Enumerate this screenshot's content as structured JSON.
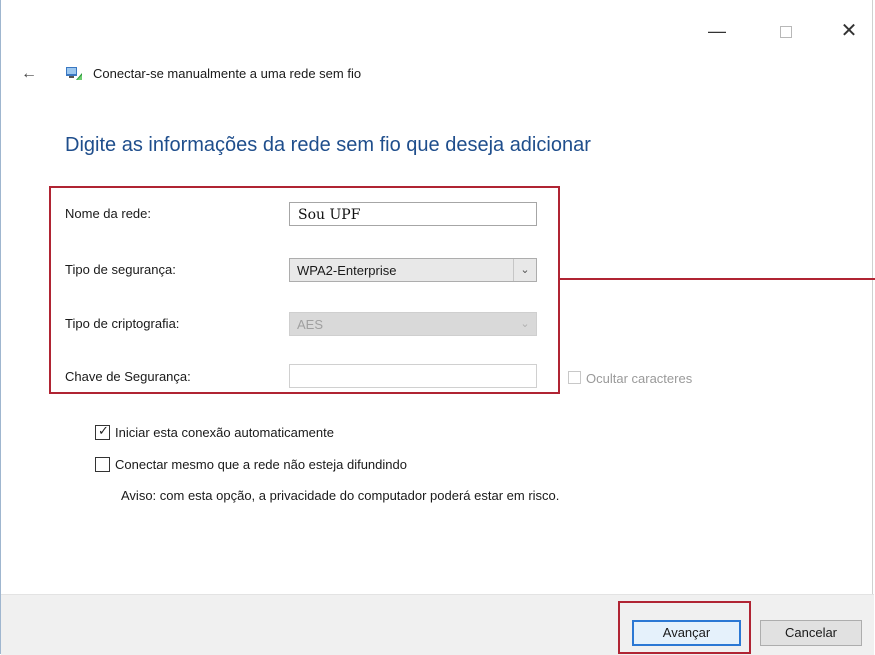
{
  "window": {
    "title": "Conectar-se manualmente a uma rede sem fio",
    "minimize": "—",
    "close": "✕"
  },
  "header": {
    "back": "←",
    "icon": "wireless-network-icon"
  },
  "page": {
    "heading": "Digite as informações da rede sem fio que deseja adicionar"
  },
  "form": {
    "network_name_label": "Nome da rede:",
    "network_name_value": "Sou UPF",
    "security_type_label": "Tipo de segurança:",
    "security_type_value": "WPA2-Enterprise",
    "encryption_label": "Tipo de criptografia:",
    "encryption_value": "AES",
    "security_key_label": "Chave de Segurança:",
    "security_key_value": "",
    "hide_chars_label": "Ocultar caracteres",
    "hide_chars_checked": false
  },
  "options": {
    "auto_start_label": "Iniciar esta conexão automaticamente",
    "auto_start_checked": true,
    "connect_hidden_label": "Conectar mesmo que a rede não esteja difundindo",
    "connect_hidden_checked": false,
    "warning": "Aviso: com esta opção, a privacidade do computador poderá estar em risco."
  },
  "footer": {
    "next_label": "Avançar",
    "cancel_label": "Cancelar"
  },
  "colors": {
    "heading": "#1f4e8c",
    "highlight": "#b02433",
    "default_button_border": "#2b78d4"
  }
}
